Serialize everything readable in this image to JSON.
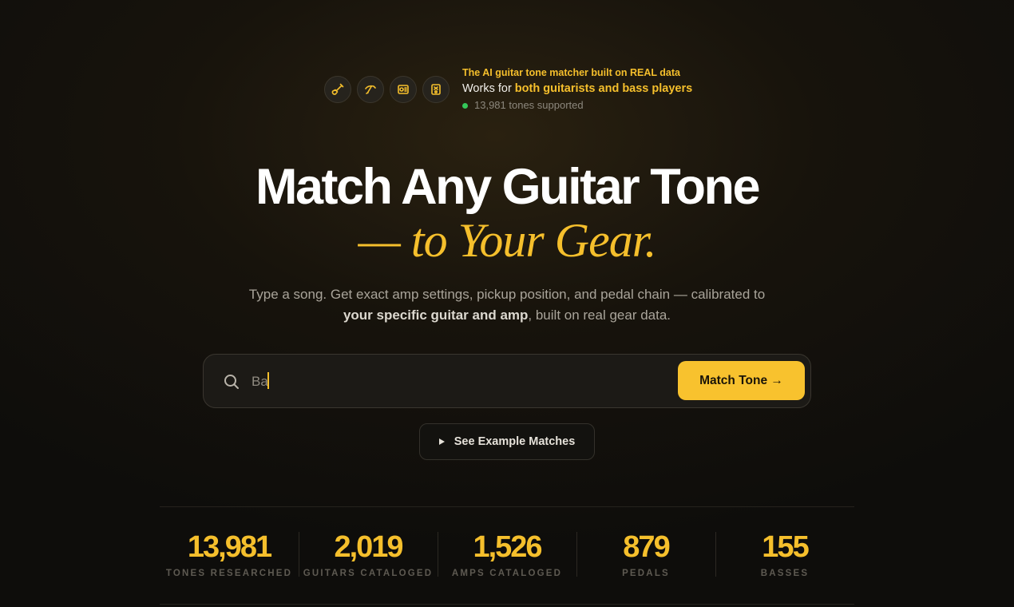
{
  "badge": {
    "icons": [
      "guitar-icon",
      "bass-guitar-icon",
      "amp-icon",
      "pedal-icon"
    ],
    "tagline": "The AI guitar tone matcher built on REAL data",
    "works_prefix": "Works for ",
    "works_highlight": "both guitarists and bass players",
    "status_text": "13,981 tones supported"
  },
  "hero": {
    "headline": "Match Any Guitar Tone",
    "subheadline": "— to Your Gear.",
    "description_part1": "Type a song. Get exact amp settings, pickup position, and pedal chain — calibrated to",
    "description_bold": "your specific guitar and amp",
    "description_part2": ", built on real gear data."
  },
  "search": {
    "value": "Ba",
    "button_label": "Match Tone →"
  },
  "example_button": {
    "label": "See Example Matches"
  },
  "stats": [
    {
      "value": "13,981",
      "label": "TONES RESEARCHED"
    },
    {
      "value": "2,019",
      "label": "GUITARS CATALOGED"
    },
    {
      "value": "1,526",
      "label": "AMPS CATALOGED"
    },
    {
      "value": "879",
      "label": "PEDALS"
    },
    {
      "value": "155",
      "label": "BASSES"
    }
  ],
  "colors": {
    "accent": "#f5bf2c",
    "status_green": "#34c759",
    "background": "#0e0d0b"
  }
}
